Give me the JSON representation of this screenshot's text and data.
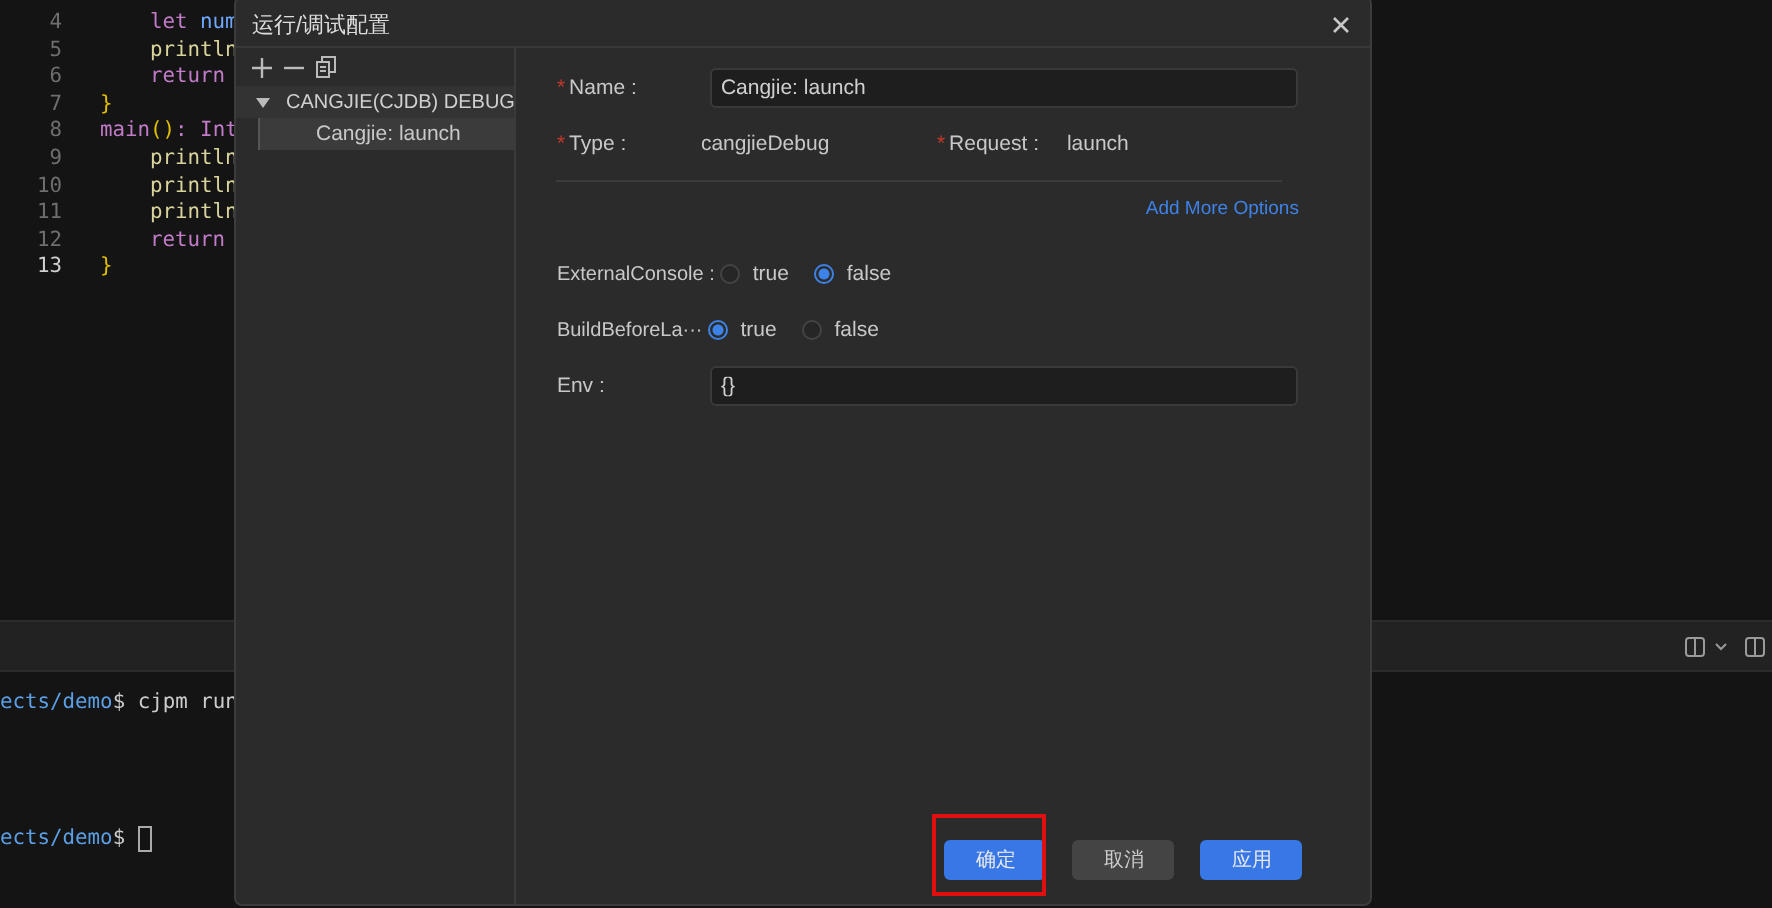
{
  "editor": {
    "lines": [
      {
        "number": "4",
        "current": false,
        "indented": true,
        "tokens": [
          {
            "text": "let",
            "kind": "keyword"
          },
          {
            "text": " num",
            "kind": "ident"
          }
        ]
      },
      {
        "number": "5",
        "current": false,
        "indented": true,
        "tokens": [
          {
            "text": "println",
            "kind": "func"
          }
        ]
      },
      {
        "number": "6",
        "current": false,
        "indented": true,
        "tokens": [
          {
            "text": "return",
            "kind": "keyword"
          }
        ]
      },
      {
        "number": "7",
        "current": false,
        "indented": false,
        "tokens": [
          {
            "text": "}",
            "kind": "brace"
          }
        ]
      },
      {
        "number": "8",
        "current": false,
        "indented": false,
        "tokens": [
          {
            "text": "main",
            "kind": "keyword"
          },
          {
            "text": "()",
            "kind": "brace"
          },
          {
            "text": ": Int",
            "kind": "keyword"
          }
        ]
      },
      {
        "number": "9",
        "current": false,
        "indented": true,
        "tokens": [
          {
            "text": "println",
            "kind": "func"
          }
        ]
      },
      {
        "number": "10",
        "current": false,
        "indented": true,
        "tokens": [
          {
            "text": "println",
            "kind": "func"
          }
        ]
      },
      {
        "number": "11",
        "current": false,
        "indented": true,
        "tokens": [
          {
            "text": "println",
            "kind": "func"
          }
        ]
      },
      {
        "number": "12",
        "current": false,
        "indented": true,
        "tokens": [
          {
            "text": "return",
            "kind": "keyword"
          }
        ]
      },
      {
        "number": "13",
        "current": true,
        "indented": false,
        "tokens": [
          {
            "text": "}",
            "kind": "brace"
          }
        ]
      }
    ]
  },
  "terminal": {
    "lines": [
      {
        "path": "ects/demo",
        "command": "$ cjpm run"
      },
      {
        "path": "ects/demo",
        "command": "$",
        "cursor": true
      }
    ]
  },
  "dialog": {
    "title": "运行/调试配置",
    "tree": [
      {
        "label": "CANGJIE(CJDB) DEBUG",
        "expanded": true,
        "children": [
          {
            "label": "Cangjie: launch",
            "selected": true
          }
        ]
      }
    ],
    "form": {
      "name": {
        "label": "Name :",
        "required_mark": "*",
        "value": "Cangjie: launch"
      },
      "type": {
        "label": "Type :",
        "required_mark": "*",
        "value": "cangjieDebug"
      },
      "request": {
        "label": "Request :",
        "required_mark": "*",
        "value": "launch"
      },
      "add_more": "Add More Options",
      "options": [
        {
          "label": "ExternalConsole :",
          "choices": [
            {
              "label": "true",
              "selected": false
            },
            {
              "label": "false",
              "selected": true
            }
          ]
        },
        {
          "label": "BuildBeforeLa···",
          "choices": [
            {
              "label": "true",
              "selected": true
            },
            {
              "label": "false",
              "selected": false
            }
          ]
        }
      ],
      "env": {
        "label": "Env :",
        "value": "{}"
      }
    },
    "buttons": [
      {
        "label": "确定",
        "kind": "primary",
        "highlighted": true
      },
      {
        "label": "取消",
        "kind": "secondary",
        "highlighted": false
      },
      {
        "label": "应用",
        "kind": "primary",
        "highlighted": false
      }
    ]
  }
}
